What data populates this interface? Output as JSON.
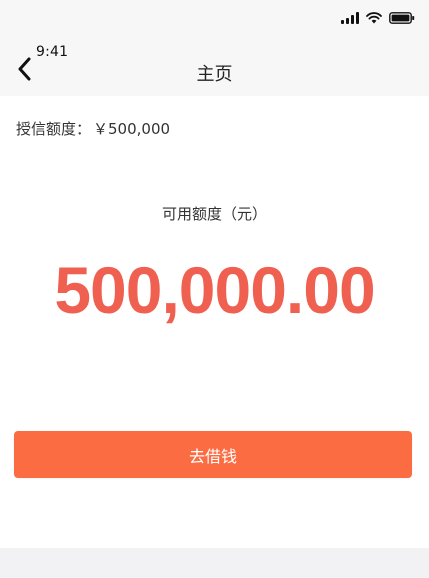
{
  "status_bar": {
    "time": "9:41",
    "icons": [
      "signal-icon",
      "wifi-icon",
      "battery-icon"
    ]
  },
  "nav": {
    "back_icon": "chevron-left-icon",
    "title": "主页"
  },
  "credit": {
    "label": "授信额度：",
    "value": "￥500,000"
  },
  "available": {
    "label": "可用额度（元）",
    "amount": "500,000.00"
  },
  "actions": {
    "borrow_label": "去借钱"
  },
  "colors": {
    "amount": "#f06050",
    "button_bg": "#fb6c43",
    "button_text": "#ffffff",
    "header_bg": "#f7f7f8",
    "bottom_bar_bg": "#f2f2f4"
  }
}
